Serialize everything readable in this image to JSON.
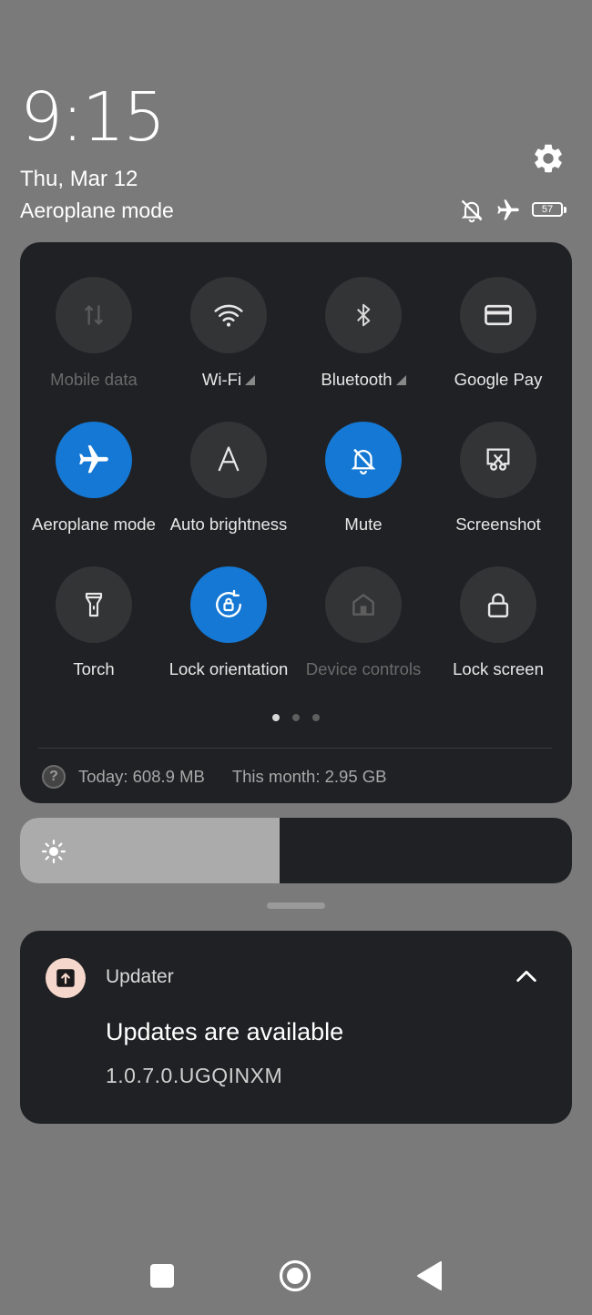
{
  "header": {
    "time": "9:15",
    "date": "Thu, Mar 12",
    "mode": "Aeroplane mode",
    "battery_level": "57",
    "status_icons": [
      "mute-icon",
      "airplane-icon",
      "battery-icon"
    ],
    "settings_icon": "gear-icon"
  },
  "tiles": [
    {
      "label": "Mobile data",
      "icon": "mobile-data-icon",
      "state": "disabled"
    },
    {
      "label": "Wi-Fi",
      "icon": "wifi-icon",
      "state": "off"
    },
    {
      "label": "Bluetooth",
      "icon": "bluetooth-icon",
      "state": "off"
    },
    {
      "label": "Google Pay",
      "icon": "card-icon",
      "state": "off"
    },
    {
      "label": "Aeroplane mode",
      "icon": "airplane-icon",
      "state": "on"
    },
    {
      "label": "Auto brightness",
      "icon": "auto-brightness-icon",
      "state": "off"
    },
    {
      "label": "Mute",
      "icon": "mute-icon",
      "state": "on"
    },
    {
      "label": "Screenshot",
      "icon": "screenshot-icon",
      "state": "off"
    },
    {
      "label": "Torch",
      "icon": "torch-icon",
      "state": "off"
    },
    {
      "label": "Lock orientation",
      "icon": "rotation-lock-icon",
      "state": "on"
    },
    {
      "label": "Device controls",
      "icon": "home-icon",
      "state": "disabled"
    },
    {
      "label": "Lock screen",
      "icon": "lock-icon",
      "state": "off"
    }
  ],
  "pager": {
    "pages": 3,
    "current": 1
  },
  "data_usage": {
    "today": "Today: 608.9 MB",
    "month": "This month: 2.95 GB"
  },
  "brightness": {
    "level_percent": 47
  },
  "notification": {
    "app": "Updater",
    "title": "Updates are available",
    "text": "1.0.7.0.UGQINXM",
    "app_color": "#f6d7cc"
  },
  "colors": {
    "accent": "#1478d4",
    "panel": "#202124",
    "tile_off": "#333436",
    "background": "#7a7a7a"
  }
}
